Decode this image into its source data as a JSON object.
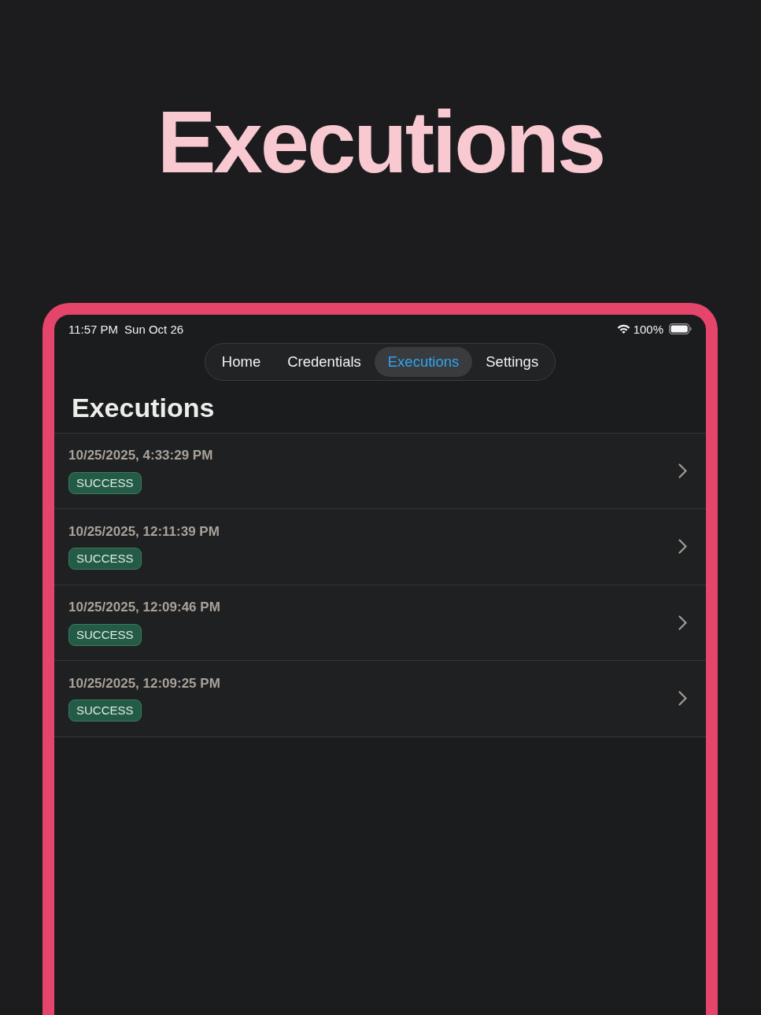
{
  "page_title": "Executions",
  "status_bar": {
    "time": "11:57 PM",
    "date": "Sun Oct 26",
    "battery": "100%"
  },
  "tabs": [
    {
      "label": "Home",
      "selected": false
    },
    {
      "label": "Credentials",
      "selected": false
    },
    {
      "label": "Executions",
      "selected": true
    },
    {
      "label": "Settings",
      "selected": false
    }
  ],
  "heading": "Executions",
  "executions": [
    {
      "timestamp": "10/25/2025, 4:33:29 PM",
      "status": "SUCCESS"
    },
    {
      "timestamp": "10/25/2025, 12:11:39 PM",
      "status": "SUCCESS"
    },
    {
      "timestamp": "10/25/2025, 12:09:46 PM",
      "status": "SUCCESS"
    },
    {
      "timestamp": "10/25/2025, 12:09:25 PM",
      "status": "SUCCESS"
    }
  ]
}
